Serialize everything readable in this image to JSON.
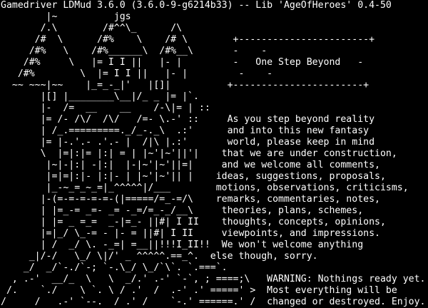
{
  "terminal": {
    "colors": {
      "background": "#000000",
      "foreground": "#ffffff"
    },
    "lines": [
      "Gamedriver LDMud 3.6.0 (3.6.0-9-g6214b33) -- Lib 'AgeOfHeroes' 0.4-50",
      "        |~          jgs",
      "       /.\\        /#^^\\_      /\\",
      "      /#  \\      /#%    \\    /# \\        +-----------------------+",
      "     /#%   \\    /#%______\\  /#%__\\       -    -",
      "    /#%     \\   |= I I ||   |- |         -   One Step Beyond   -",
      "   /#%        \\  |= I I ||   |- |         -    -",
      "  ~~ ~~~|~~    |_=_-_|'   |[]|          +-----------------------+",
      "       |[] |________\\__|/_ _ |= |`.",
      "       |-  /=  __    __    /-\\|= | ::",
      "       |= /- /\\/  /\\/   /=- \\.-' ::     As you step beyond reality",
      "       | /_.=========._/_-._\\  .:'      and into this new fantasy",
      "       |= |-.'.- .'.- |  /|\\ |.:'       world, please keep in mind",
      "       \\  |=|:|= |:| = | |~'|~'||'|    that we are under construction,",
      "        |~|-|:| -|:|  |-|~'|~'||=|     and we welcome all comments,",
      "        |=|=|:|- |:|- | |~'|~'|| |    ideas, suggestions, proposals,",
      "        |_-~_=_~_=|_^^^^^|/___        motions, observations, criticisms,",
      "       |-(=-=-=-=-=-(|=====/=_-=/\\    remarks, commentaries, notes,",
      "       | |=_-= _=- _= -_=/=_-_/__\\     theories, plans, schemes,",
      "       | |= _ =_=  _-|=_- ||#| I II    thoughts, concepts, opinions,",
      "       |=|_/ \\_-= - |- = ||#| I II     viewpoints, and impressions.",
      "       | /  _/ \\. -_=| =__||!!!I_II!!  We won't welcome anything",
      "     _|/-/   \\_/ \\|/' _ ^^^^^.==_^.  else though, sorry.",
      "    _/  _/`-./`-; `-.\\_/ \\_/`\\`. `.===`.",
      "  , .-'  __/_  \\   \\  _/.' .-' `-`, ; ====;\\   WARNING: Nothings ready yet.",
      " /.    `./    \\ `. \\ / .'  /  .-' .' =====' >  Most everything will be",
      "/     /   .-' `--.  / .' /    `-.' ======.' /  changed or destroyed. Enjoy."
    ]
  }
}
